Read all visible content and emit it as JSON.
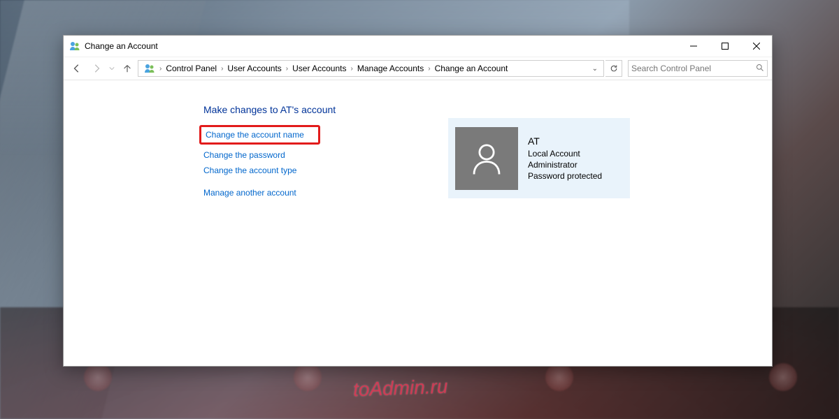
{
  "window": {
    "title": "Change an Account"
  },
  "breadcrumb": {
    "items": [
      "Control Panel",
      "User Accounts",
      "User Accounts",
      "Manage Accounts",
      "Change an Account"
    ]
  },
  "search": {
    "placeholder": "Search Control Panel"
  },
  "page": {
    "heading": "Make changes to AT's account",
    "links": {
      "change_name": "Change the account name",
      "change_password": "Change the password",
      "change_type": "Change the account type",
      "manage_another": "Manage another account"
    }
  },
  "account": {
    "name": "AT",
    "type": "Local Account",
    "role": "Administrator",
    "protection": "Password protected"
  },
  "watermark": "toAdmin.ru"
}
